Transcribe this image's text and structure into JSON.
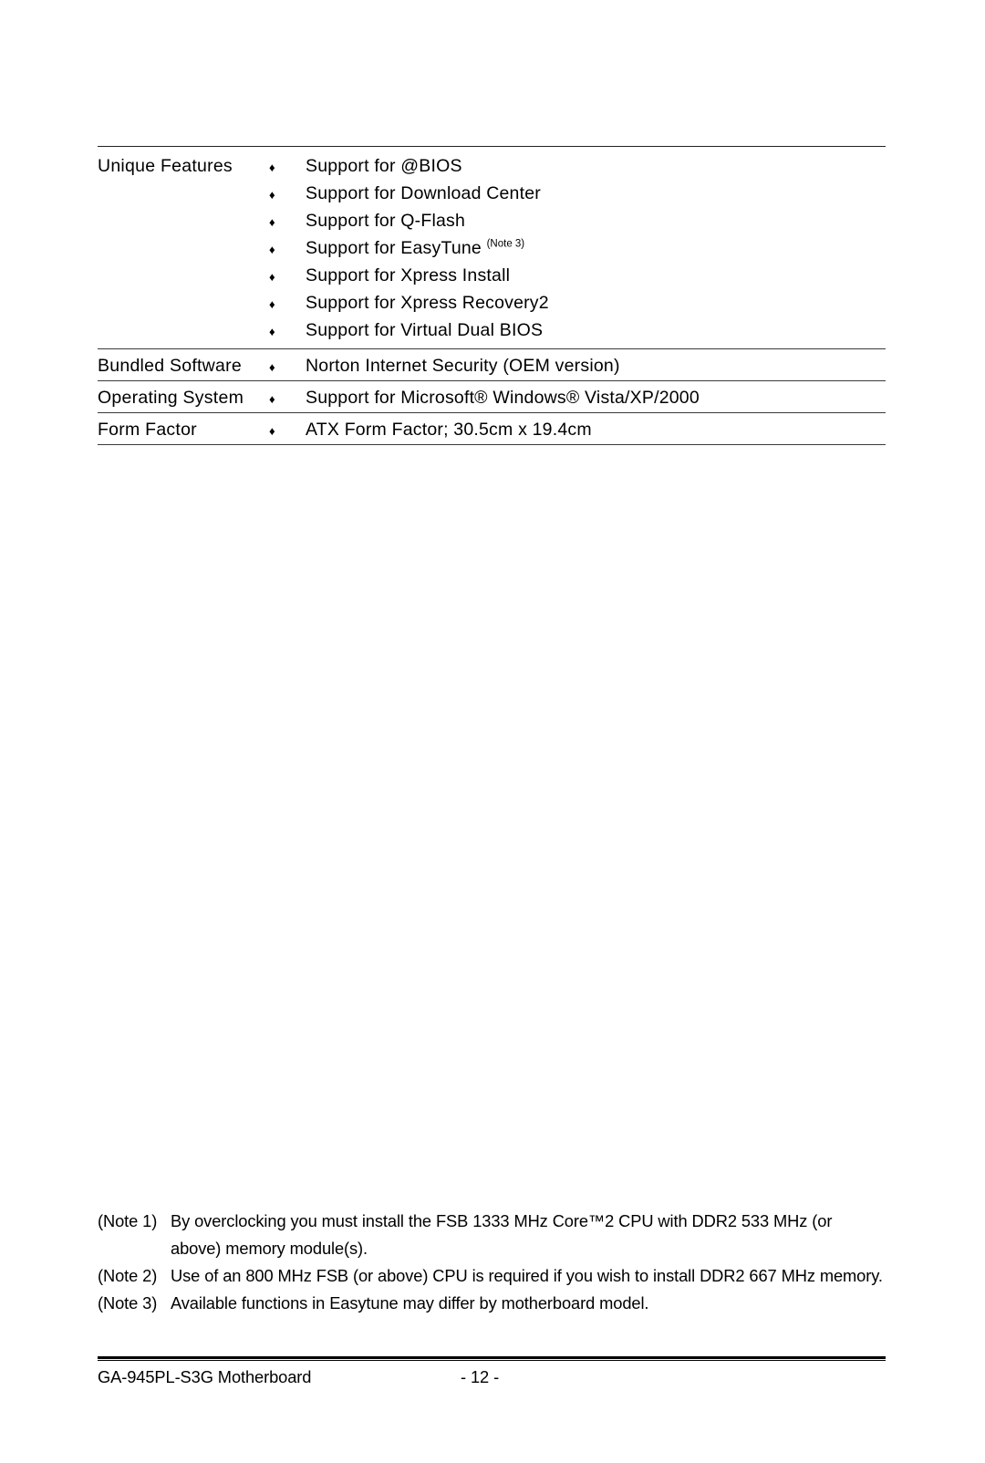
{
  "document": {
    "title": "GA-945PL-S3G Motherboard",
    "page_number": "- 12 -"
  },
  "spec_table": {
    "rows": [
      {
        "label": "Unique Features",
        "bullet": "♦",
        "items": [
          {
            "text": "Support for @BIOS",
            "note": ""
          },
          {
            "text": "Support for Download Center",
            "note": ""
          },
          {
            "text": "Support for Q-Flash",
            "note": ""
          },
          {
            "text": "Support for EasyTune ",
            "note": "(Note 3)"
          },
          {
            "text": "Support for Xpress Install",
            "note": ""
          },
          {
            "text": "Support for Xpress Recovery2",
            "note": ""
          },
          {
            "text": "Support for Virtual Dual BIOS",
            "note": ""
          }
        ]
      },
      {
        "label": "Bundled Software",
        "bullet": "♦",
        "items": [
          {
            "text": "Norton Internet Security (OEM version)",
            "note": ""
          }
        ]
      },
      {
        "label": "Operating System",
        "bullet": "♦",
        "items": [
          {
            "text": "Support for Microsoft® Windows® Vista/XP/2000",
            "note": ""
          }
        ]
      },
      {
        "label": "Form Factor",
        "bullet": "♦",
        "items": [
          {
            "text": "ATX Form Factor; 30.5cm x 19.4cm",
            "note": ""
          }
        ]
      }
    ]
  },
  "footnotes": [
    {
      "marker": "(Note 1)",
      "line1": "By overclocking you must install the FSB 1333 MHz Core™2 CPU with DDR2 533 MHz (or",
      "line2": "above) memory module(s)."
    },
    {
      "marker": "(Note 2)",
      "line1": "Use of an 800 MHz FSB (or above) CPU is required if you wish to install DDR2 667 MHz memory.",
      "line2": ""
    },
    {
      "marker": "(Note 3)",
      "line1": "Available functions in Easytune may differ by motherboard model.",
      "line2": ""
    }
  ]
}
